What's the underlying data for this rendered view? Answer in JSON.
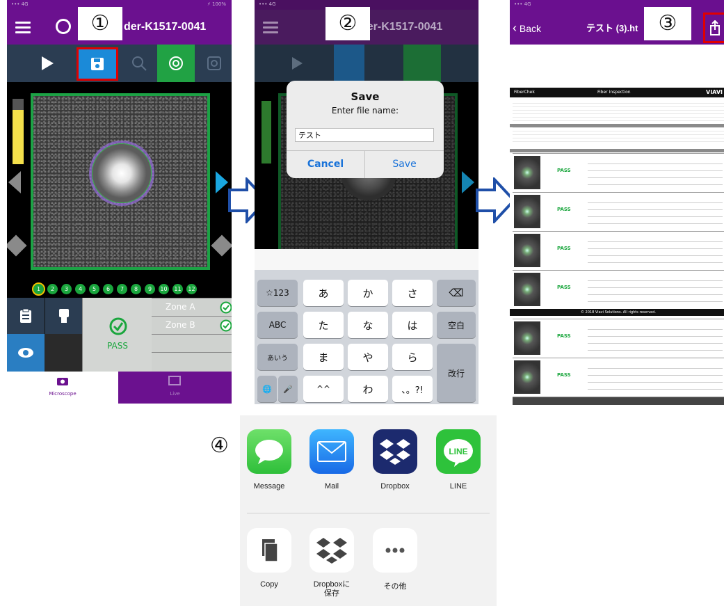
{
  "step_labels": [
    "①",
    "②",
    "③",
    "④"
  ],
  "panel1": {
    "header_title": "der-K1517-0041",
    "fiber_numbers": [
      "1",
      "2",
      "3",
      "4",
      "5",
      "6",
      "7",
      "8",
      "9",
      "10",
      "11",
      "12"
    ],
    "zones": [
      "Zone A",
      "Zone B"
    ],
    "result": "PASS",
    "tabs": [
      "Microscope",
      "Live"
    ]
  },
  "panel2": {
    "header_title": "der-K1517-0041",
    "dialog_title": "Save",
    "dialog_message": "Enter file name:",
    "file_name_value": "テスト",
    "cancel_label": "Cancel",
    "save_label": "Save",
    "keyboard": {
      "row1": [
        "☆123",
        "あ",
        "か",
        "さ",
        "⌫"
      ],
      "row2": [
        "ABC",
        "た",
        "な",
        "は",
        "空白"
      ],
      "row3": [
        "あいう",
        "ま",
        "や",
        "ら",
        "改行"
      ],
      "row4": [
        "🌐",
        "🎤",
        "^^",
        "わ",
        "、。?!"
      ]
    }
  },
  "panel3": {
    "back_label": "Back",
    "header_title": "テスト (3).ht",
    "report": {
      "brand": "FiberChek",
      "title": "Fiber Inspection",
      "vendor": "VIAVI",
      "result": "PASS",
      "footer": "© 2018 Viavi Solutions. All rights reserved."
    }
  },
  "panel4": {
    "apps": [
      "Message",
      "Mail",
      "Dropbox",
      "LINE"
    ],
    "actions": [
      "Copy",
      "Dropboxに\n保存",
      "その他"
    ]
  },
  "colors": {
    "header_purple": "#6b118f",
    "toolbar": "#2b3d52",
    "highlight_red": "#e00000",
    "pass_green": "#1aa63d",
    "arrow_blue": "#1f4fa8"
  }
}
